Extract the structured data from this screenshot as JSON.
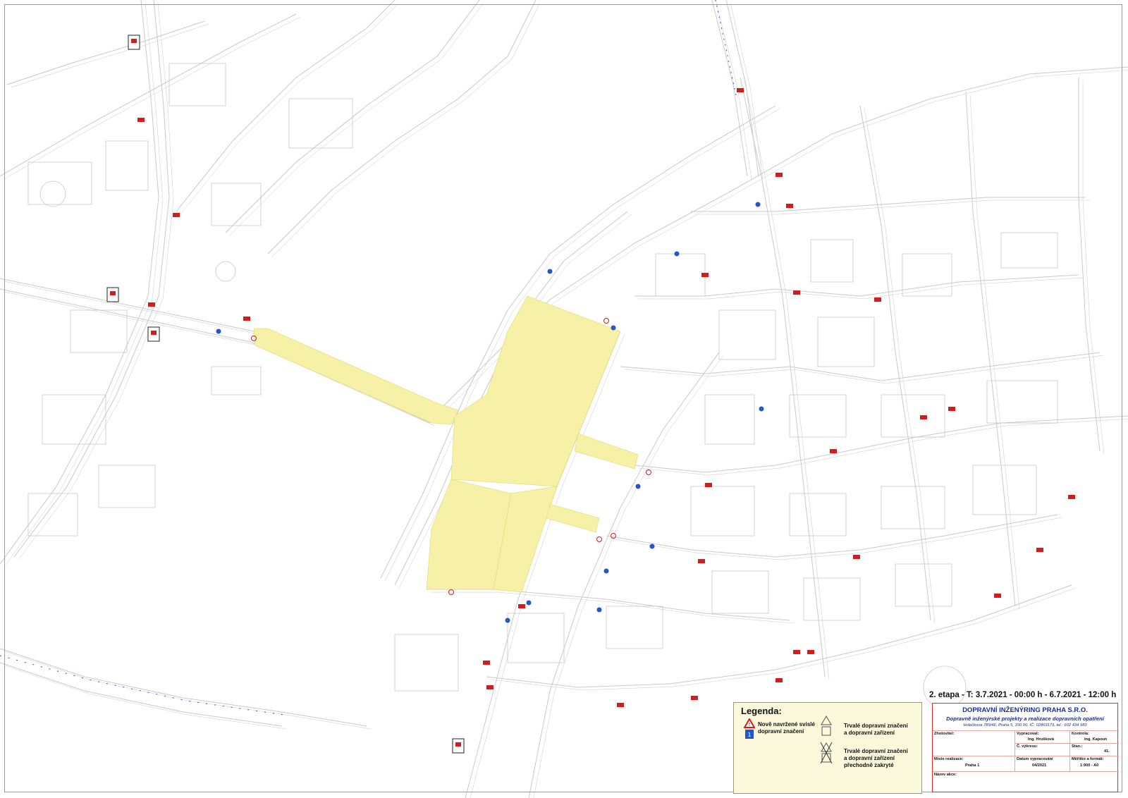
{
  "stage_text": "2. etapa - T: 3.7.2021 - 00:00 h - 6.7.2021 - 12:00 h",
  "colors": {
    "work_zone": "#f6f1a6",
    "title_border": "#e32b2b",
    "company_blue": "#1b2f8f",
    "legend_bg": "#fbf8dc",
    "street": "#c9c9c9",
    "sign_red": "#d41c1c",
    "sign_blue": "#2556c8"
  },
  "legend": {
    "title": "Legenda:",
    "items": [
      {
        "icon": "new-sign-icon",
        "label": "Nově navržené svislé\ndopravní značení"
      },
      {
        "icon": "permanent-sign-icon",
        "label": "Trvalé dopravní značení\na dopravní zařízení"
      },
      {
        "icon": "covered-sign-icon",
        "label": "Trvalé dopravní značení\na dopravní zařízení\npřechodně zakryté"
      }
    ]
  },
  "title_block": {
    "company": "DOPRAVNÍ INŽENÝRING PRAHA S.R.O.",
    "subtitle": "Dopravně inženýrské projekty a realizace dopravních opatření",
    "address": "Holečkova 789/46, Praha 5, 150 00, IČ: 02869179, tel.: 602 434 983",
    "zhotovitel_label": "Zhotovitel:",
    "vypracoval_label": "Vypracoval:",
    "vypracoval_value": "Ing. Hrušková",
    "kontrola_label": "Kontrola:",
    "kontrola_value": "Ing. Kapoun",
    "vykres_label": "Č. výkresu:",
    "stan_label": "Stan.:",
    "stan_value": "41.",
    "misto_label": "Místo realizace:",
    "misto_value": "Praha 1",
    "datum_label": "Datum vypracování",
    "datum_value": "04/2021",
    "meritko_label": "Měřítko a formát:",
    "meritko_value": "1:900 - A0",
    "nazev_label": "Název akce:"
  }
}
